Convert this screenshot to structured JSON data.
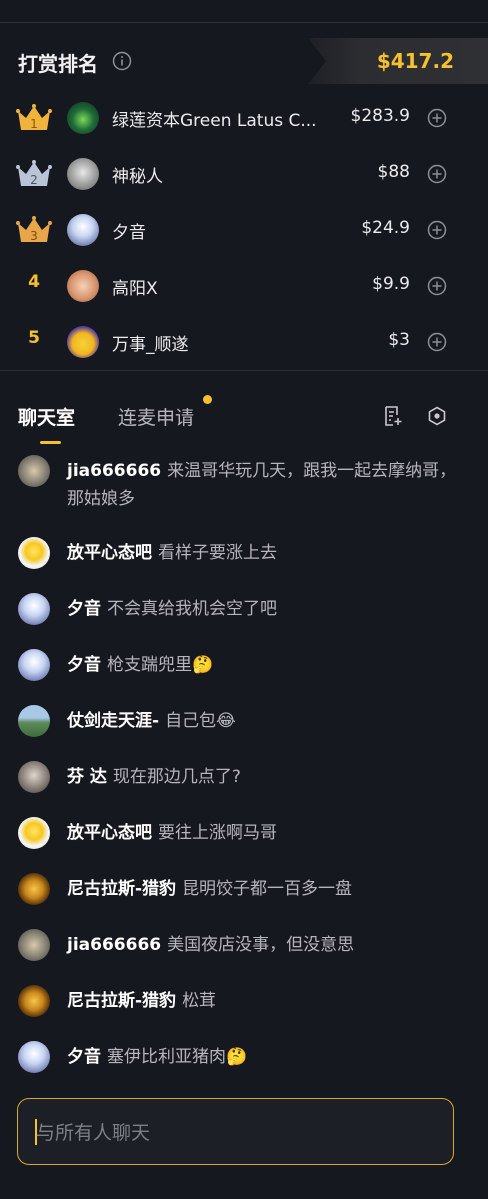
{
  "ranking": {
    "title": "打赏排名",
    "total": "$417.2",
    "rows": [
      {
        "rank": "1",
        "name": "绿莲资本Green Latus C...",
        "amount": "$283.9"
      },
      {
        "rank": "2",
        "name": "神秘人",
        "amount": "$88"
      },
      {
        "rank": "3",
        "name": "夕音",
        "amount": "$24.9"
      },
      {
        "rank": "4",
        "name": "高阳X",
        "amount": "$9.9"
      },
      {
        "rank": "5",
        "name": "万事_顺遂",
        "amount": "$3"
      }
    ]
  },
  "tabs": {
    "chat": "聊天室",
    "link_request": "连麦申请"
  },
  "messages": [
    {
      "user": "jia666666",
      "text": "来温哥华玩几天，跟我一起去摩纳哥，那姑娘多"
    },
    {
      "user": "放平心态吧",
      "text": "看样子要涨上去"
    },
    {
      "user": "夕音",
      "text": "不会真给我机会空了吧"
    },
    {
      "user": "夕音",
      "text": "枪支踹兜里🤔"
    },
    {
      "user": "仗剑走天涯-",
      "text": "自己包😂"
    },
    {
      "user": "芬 达",
      "text": "现在那边几点了?"
    },
    {
      "user": "放平心态吧",
      "text": "要往上涨啊马哥"
    },
    {
      "user": "尼古拉斯-猎豹",
      "text": "昆明饺子都一百多一盘"
    },
    {
      "user": "jia666666",
      "text": "美国夜店没事，但没意思"
    },
    {
      "user": "尼古拉斯-猎豹",
      "text": "松茸"
    },
    {
      "user": "夕音",
      "text": "塞伊比利亚猪肉🤔"
    }
  ],
  "input": {
    "placeholder": "与所有人聊天"
  },
  "colors": {
    "accent": "#f5c12e",
    "background": "#16181f",
    "gold_crown": "#f0b43c",
    "silver_crown": "#b9c4d6"
  }
}
